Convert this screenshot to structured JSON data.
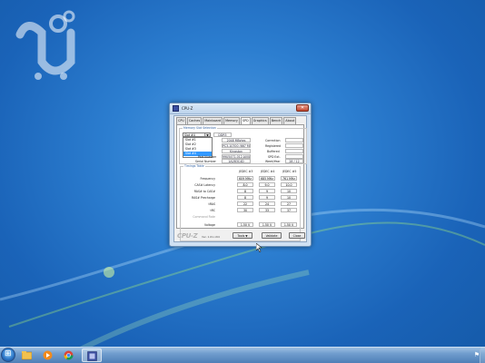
{
  "window": {
    "title": "CPU-Z",
    "tabs": [
      "CPU",
      "Caches",
      "Mainboard",
      "Memory",
      "SPD",
      "Graphics",
      "Bench",
      "About"
    ],
    "active_tab": "SPD"
  },
  "slot": {
    "group_label": "Memory Slot Selection",
    "selected": "Slot #4",
    "options": [
      "Slot #1",
      "Slot #2",
      "Slot #3",
      "Slot #4"
    ],
    "type": "DDR3",
    "module_size_label": "Module Size",
    "module_size": "2048 MBytes",
    "max_bandwidth_label": "Max Bandwidth",
    "max_bandwidth": "PC3-10700 (667 MHz)",
    "manufacturer_label": "Manufacturer",
    "manufacturer": "Kingston",
    "part_number_label": "Part Number",
    "part_number": "99U5471-012.A00LF",
    "serial_number_label": "Serial Number",
    "serial_number": "1A2B3C4D",
    "correction_label": "Correction",
    "correction": "",
    "registered_label": "Registered",
    "registered": "",
    "buffered_label": "Buffered",
    "buffered": "",
    "spd_ext_label": "SPD Ext.",
    "spd_ext": "",
    "week_year_label": "Week/Year",
    "week_year": "28 / 12"
  },
  "timings": {
    "group_label": "Timings Table",
    "columns": [
      "JEDEC #3",
      "JEDEC #4",
      "JEDEC #5"
    ],
    "freq_row": [
      "609 MHz",
      "685 MHz",
      "761 MHz"
    ],
    "rows": [
      {
        "label": "Frequency",
        "values": [
          "609 MHz",
          "685 MHz",
          "761 MHz"
        ]
      },
      {
        "label": "CAS# Latency",
        "values": [
          "8.0",
          "9.0",
          "10.0"
        ]
      },
      {
        "label": "RAS# to CAS#",
        "values": [
          "8",
          "9",
          "10"
        ]
      },
      {
        "label": "RAS# Precharge",
        "values": [
          "8",
          "9",
          "10"
        ]
      },
      {
        "label": "tRAS",
        "values": [
          "22",
          "24",
          "27"
        ]
      },
      {
        "label": "tRC",
        "values": [
          "30",
          "33",
          "37"
        ]
      },
      {
        "label": "Command Rate",
        "values": [
          "",
          "",
          ""
        ]
      },
      {
        "label": "Voltage",
        "values": [
          "1.50 V",
          "1.50 V",
          "1.50 V"
        ]
      }
    ]
  },
  "footer": {
    "brand": "CPU-Z",
    "version": "Ver. 1.61.x64",
    "tools_label": "Tools",
    "validate_label": "Validate",
    "close_label": "Close"
  },
  "taskbar": {
    "items": [
      "start",
      "explorer",
      "media-player",
      "chrome",
      "cpu-z"
    ]
  },
  "colors": {
    "desktop_blue": "#2c7ed0",
    "selection": "#3399ff",
    "group_label": "#3060a0"
  }
}
